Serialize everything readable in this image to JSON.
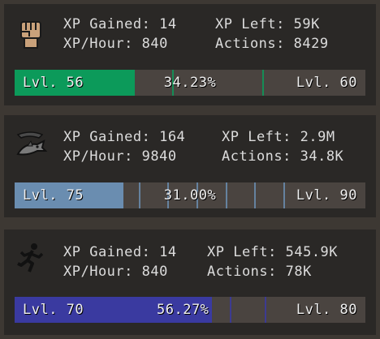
{
  "colors": {
    "background": "#3d3833",
    "panel": "#2a2826",
    "bar_track": "#4a4440"
  },
  "skills": [
    {
      "icon": "fist-icon",
      "xp_gained": "XP Gained: 14",
      "xp_hour": "XP/Hour: 840",
      "xp_left": "XP Left: 59K",
      "actions": "Actions: 8429",
      "level_current": "Lvl. 56",
      "level_target": "Lvl. 60",
      "progress_text": "34.23%",
      "progress": 0.3423,
      "bar_color": "#0c9a5a",
      "tick_color": "#0c9a5a"
    },
    {
      "icon": "shark-icon",
      "xp_gained": "XP Gained: 164",
      "xp_hour": "XP/Hour: 9840",
      "xp_left": "XP Left: 2.9M",
      "actions": "Actions: 34.8K",
      "level_current": "Lvl. 75",
      "level_target": "Lvl. 90",
      "progress_text": "31.00%",
      "progress": 0.31,
      "bar_color": "#6a8db0",
      "tick_color": "#6a8db0"
    },
    {
      "icon": "running-figure-icon",
      "xp_gained": "XP Gained: 14",
      "xp_hour": "XP/Hour: 840",
      "xp_left": "XP Left: 545.9K",
      "actions": "Actions: 78K",
      "level_current": "Lvl. 70",
      "level_target": "Lvl. 80",
      "progress_text": "56.27%",
      "progress": 0.5627,
      "bar_color": "#3a3aa0",
      "tick_color": "#3a3aa0"
    }
  ]
}
